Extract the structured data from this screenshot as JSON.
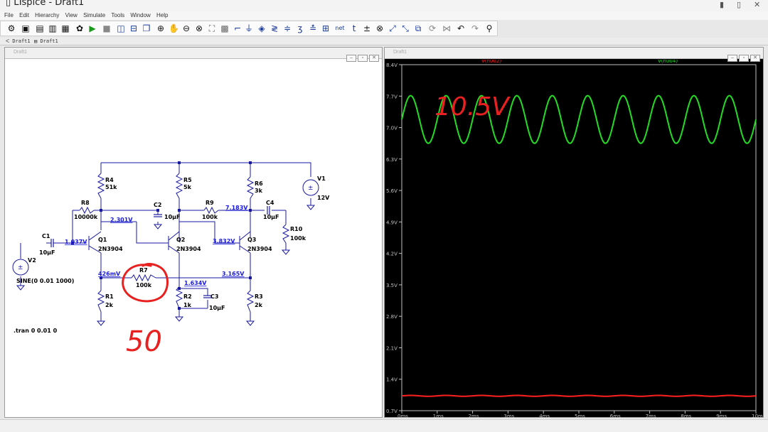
{
  "app": {
    "title": "LTspice - Draft1",
    "minimize": "▮",
    "maximize": "▯",
    "close": "✕"
  },
  "menu": [
    "File",
    "Edit",
    "Hierarchy",
    "View",
    "Simulate",
    "Tools",
    "Window",
    "Help"
  ],
  "tabs": [
    "Draft1",
    "Draft1"
  ],
  "schematic": {
    "title": "Draft1",
    "components": {
      "r4": {
        "name": "R4",
        "value": "51k"
      },
      "r5": {
        "name": "R5",
        "value": "5k"
      },
      "r6": {
        "name": "R6",
        "value": "3k"
      },
      "r8": {
        "name": "R8",
        "value": "10000k"
      },
      "r9": {
        "name": "R9",
        "value": "100k"
      },
      "r10": {
        "name": "R10",
        "value": "100k"
      },
      "r7": {
        "name": "R7",
        "value": "100k"
      },
      "r1": {
        "name": "R1",
        "value": "2k"
      },
      "r2": {
        "name": "R2",
        "value": "1k"
      },
      "r3": {
        "name": "R3",
        "value": "2k"
      },
      "c1": {
        "name": "C1",
        "value": "10µF"
      },
      "c2": {
        "name": "C2",
        "value": "10µF"
      },
      "c3": {
        "name": "C3",
        "value": "10µF"
      },
      "c4": {
        "name": "C4",
        "value": "10µF"
      },
      "q1": {
        "name": "Q1",
        "value": "2N3904"
      },
      "q2": {
        "name": "Q2",
        "value": "2N3904"
      },
      "q3": {
        "name": "Q3",
        "value": "2N3904"
      },
      "v1": {
        "name": "V1",
        "value": "12V"
      },
      "v2": {
        "name": "V2",
        "value": "SINE(0 0.01 1000)"
      }
    },
    "voltages": {
      "n1": "2.301V",
      "n2": "7.183V",
      "n3": "1.037V",
      "n4": "3.832V",
      "n5": "426mV",
      "n6": "1.634V",
      "n7": "3.165V"
    },
    "directive": ".tran 0 0.01 0",
    "annotations": {
      "circle_number": "50"
    }
  },
  "plot": {
    "title": "Draft1",
    "annotation": "10.5V",
    "chart_data": {
      "type": "line",
      "title": "",
      "xlabel": "",
      "ylabel": "",
      "xlim": [
        0,
        10
      ],
      "ylim": [
        0.7,
        8.4
      ],
      "x_ticks": [
        "0ms",
        "1ms",
        "2ms",
        "3ms",
        "4ms",
        "5ms",
        "6ms",
        "7ms",
        "8ms",
        "9ms",
        "10ms"
      ],
      "y_ticks": [
        "0.7V",
        "1.4V",
        "2.1V",
        "2.8V",
        "3.5V",
        "4.2V",
        "4.9V",
        "5.6V",
        "6.3V",
        "7.0V",
        "7.7V",
        "8.4V"
      ],
      "y_tick_values": [
        0.7,
        1.4,
        2.1,
        2.8,
        3.5,
        4.2,
        4.9,
        5.6,
        6.3,
        7.0,
        7.7,
        8.4
      ],
      "grid": false,
      "series": [
        {
          "name": "V(n002)",
          "color": "#ff2020",
          "waveform": "sine",
          "offset": 1.03,
          "amplitude": 0.01,
          "frequency_khz": 1
        },
        {
          "name": "V(n004)",
          "color": "#22dd22",
          "waveform": "sine",
          "offset": 7.18,
          "amplitude": 0.53,
          "frequency_khz": 1
        }
      ]
    }
  }
}
